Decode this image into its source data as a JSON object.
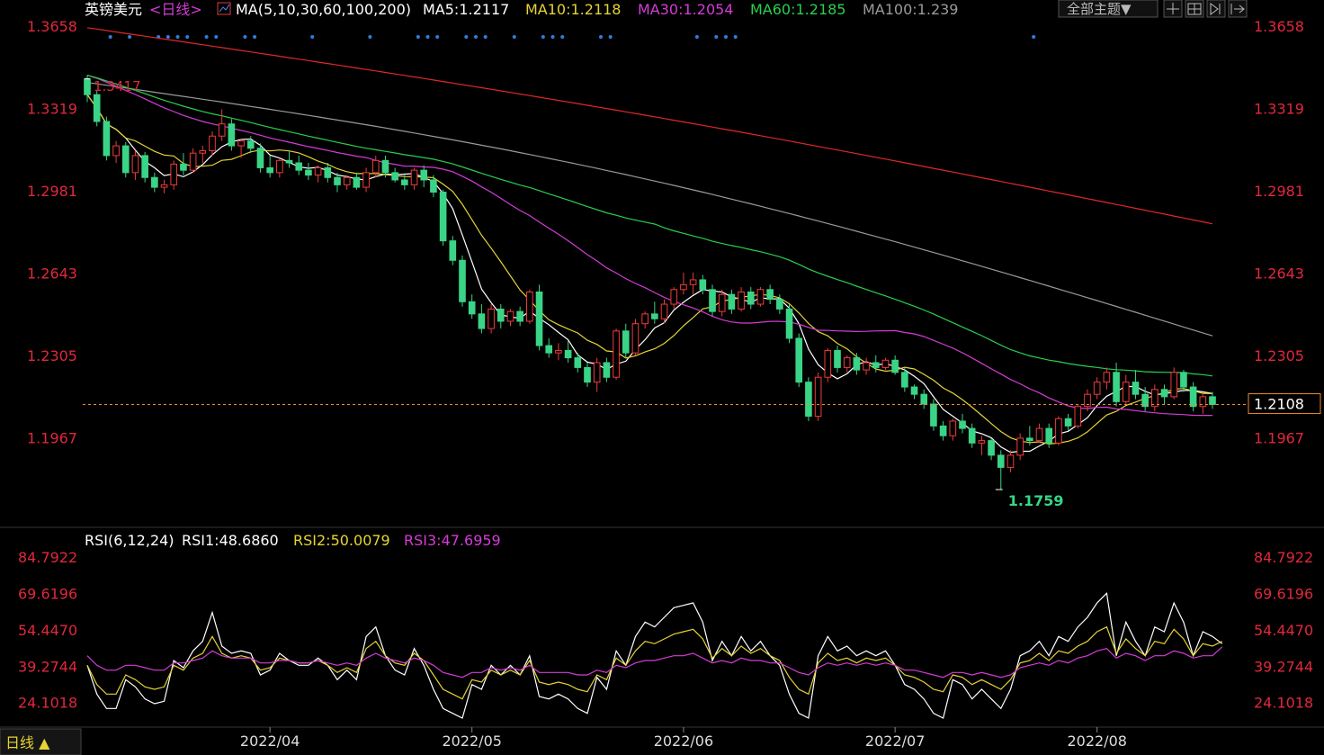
{
  "header": {
    "instrument": "英镑美元",
    "period_tag": "<日线>",
    "ma_def": "MA(5,10,30,60,100,200)",
    "ma5": "MA5:1.2117",
    "ma10": "MA10:1.2118",
    "ma30": "MA30:1.2054",
    "ma60": "MA60:1.2185",
    "ma100": "MA100:1.239",
    "theme_button": "全部主题▼"
  },
  "rsi_header": {
    "def": "RSI(6,12,24)",
    "rsi1": "RSI1:48.6860",
    "rsi2": "RSI2:50.0079",
    "rsi3": "RSI3:47.6959"
  },
  "bottom": {
    "period_button": "日线 ▲"
  },
  "colors": {
    "up": "#ef3b3b",
    "down": "#3ad486",
    "ma5": "#ffffff",
    "ma10": "#e6d335",
    "ma30": "#d43cd6",
    "ma60": "#29d04c",
    "ma100": "#9a9a9a",
    "ma200": "#e0282a",
    "axis_label": "#e0283c",
    "current_price_line": "#f08a2a",
    "dots": "#2f7de0"
  },
  "chart_data": [
    {
      "type": "candlestick",
      "title": "英镑美元<日线>",
      "y_ticks": [
        "1.3658",
        "1.3319",
        "1.2981",
        "1.2643",
        "1.2305",
        "1.1967"
      ],
      "ylim": [
        1.17,
        1.368
      ],
      "x_ticks": [
        "2022/04",
        "2022/05",
        "2022/06",
        "2022/07",
        "2022/08"
      ],
      "x_tick_index": [
        19,
        40,
        62,
        84,
        105
      ],
      "current_price": "1.2108",
      "high_label": "1.3417",
      "low_label": "1.1759",
      "ohlc": [
        [
          1.3445,
          1.346,
          1.335,
          1.338
        ],
        [
          1.338,
          1.3395,
          1.325,
          1.327
        ],
        [
          1.327,
          1.329,
          1.311,
          1.313
        ],
        [
          1.313,
          1.319,
          1.31,
          1.317
        ],
        [
          1.317,
          1.3185,
          1.304,
          1.306
        ],
        [
          1.306,
          1.315,
          1.303,
          1.313
        ],
        [
          1.313,
          1.3145,
          1.302,
          1.304
        ],
        [
          1.304,
          1.306,
          1.298,
          1.3
        ],
        [
          1.3,
          1.303,
          1.2975,
          1.301
        ],
        [
          1.301,
          1.311,
          1.299,
          1.3095
        ],
        [
          1.3095,
          1.314,
          1.305,
          1.307
        ],
        [
          1.307,
          1.316,
          1.306,
          1.314
        ],
        [
          1.314,
          1.317,
          1.31,
          1.315
        ],
        [
          1.315,
          1.323,
          1.313,
          1.321
        ],
        [
          1.321,
          1.332,
          1.319,
          1.326
        ],
        [
          1.326,
          1.328,
          1.315,
          1.317
        ],
        [
          1.317,
          1.32,
          1.312,
          1.319
        ],
        [
          1.319,
          1.321,
          1.314,
          1.316
        ],
        [
          1.316,
          1.318,
          1.306,
          1.308
        ],
        [
          1.308,
          1.313,
          1.304,
          1.306
        ],
        [
          1.306,
          1.312,
          1.304,
          1.311
        ],
        [
          1.311,
          1.315,
          1.308,
          1.31
        ],
        [
          1.31,
          1.313,
          1.305,
          1.307
        ],
        [
          1.307,
          1.31,
          1.303,
          1.305
        ],
        [
          1.305,
          1.309,
          1.302,
          1.308
        ],
        [
          1.308,
          1.31,
          1.302,
          1.304
        ],
        [
          1.304,
          1.306,
          1.298,
          1.301
        ],
        [
          1.301,
          1.305,
          1.299,
          1.304
        ],
        [
          1.304,
          1.306,
          1.299,
          1.3
        ],
        [
          1.3,
          1.308,
          1.298,
          1.306
        ],
        [
          1.306,
          1.313,
          1.304,
          1.311
        ],
        [
          1.311,
          1.313,
          1.304,
          1.306
        ],
        [
          1.306,
          1.308,
          1.302,
          1.303
        ],
        [
          1.303,
          1.305,
          1.299,
          1.301
        ],
        [
          1.301,
          1.308,
          1.299,
          1.307
        ],
        [
          1.307,
          1.309,
          1.3,
          1.303
        ],
        [
          1.303,
          1.305,
          1.296,
          1.298
        ],
        [
          1.298,
          1.299,
          1.276,
          1.278
        ],
        [
          1.278,
          1.28,
          1.268,
          1.27
        ],
        [
          1.27,
          1.272,
          1.251,
          1.253
        ],
        [
          1.253,
          1.256,
          1.246,
          1.248
        ],
        [
          1.248,
          1.252,
          1.24,
          1.242
        ],
        [
          1.242,
          1.252,
          1.24,
          1.25
        ],
        [
          1.25,
          1.252,
          1.242,
          1.245
        ],
        [
          1.245,
          1.25,
          1.243,
          1.249
        ],
        [
          1.249,
          1.251,
          1.243,
          1.245
        ],
        [
          1.245,
          1.258,
          1.244,
          1.257
        ],
        [
          1.257,
          1.26,
          1.233,
          1.235
        ],
        [
          1.235,
          1.238,
          1.23,
          1.232
        ],
        [
          1.232,
          1.236,
          1.229,
          1.233
        ],
        [
          1.233,
          1.237,
          1.228,
          1.23
        ],
        [
          1.23,
          1.232,
          1.224,
          1.226
        ],
        [
          1.226,
          1.228,
          1.218,
          1.22
        ],
        [
          1.22,
          1.23,
          1.216,
          1.228
        ],
        [
          1.228,
          1.23,
          1.22,
          1.222
        ],
        [
          1.222,
          1.242,
          1.221,
          1.241
        ],
        [
          1.241,
          1.244,
          1.23,
          1.232
        ],
        [
          1.232,
          1.246,
          1.231,
          1.244
        ],
        [
          1.244,
          1.249,
          1.242,
          1.248
        ],
        [
          1.248,
          1.253,
          1.244,
          1.246
        ],
        [
          1.246,
          1.254,
          1.244,
          1.252
        ],
        [
          1.252,
          1.259,
          1.25,
          1.258
        ],
        [
          1.258,
          1.265,
          1.256,
          1.26
        ],
        [
          1.26,
          1.265,
          1.256,
          1.262
        ],
        [
          1.262,
          1.264,
          1.256,
          1.258
        ],
        [
          1.258,
          1.26,
          1.247,
          1.249
        ],
        [
          1.249,
          1.258,
          1.247,
          1.256
        ],
        [
          1.256,
          1.258,
          1.248,
          1.25
        ],
        [
          1.25,
          1.259,
          1.249,
          1.257
        ],
        [
          1.257,
          1.259,
          1.25,
          1.252
        ],
        [
          1.252,
          1.259,
          1.251,
          1.258
        ],
        [
          1.258,
          1.26,
          1.252,
          1.254
        ],
        [
          1.254,
          1.256,
          1.248,
          1.25
        ],
        [
          1.25,
          1.252,
          1.236,
          1.238
        ],
        [
          1.238,
          1.24,
          1.218,
          1.22
        ],
        [
          1.22,
          1.222,
          1.204,
          1.206
        ],
        [
          1.206,
          1.224,
          1.204,
          1.222
        ],
        [
          1.222,
          1.234,
          1.22,
          1.233
        ],
        [
          1.233,
          1.235,
          1.224,
          1.226
        ],
        [
          1.226,
          1.231,
          1.224,
          1.23
        ],
        [
          1.23,
          1.232,
          1.223,
          1.225
        ],
        [
          1.225,
          1.23,
          1.223,
          1.228
        ],
        [
          1.228,
          1.231,
          1.224,
          1.226
        ],
        [
          1.226,
          1.23,
          1.225,
          1.229
        ],
        [
          1.229,
          1.231,
          1.223,
          1.224
        ],
        [
          1.224,
          1.226,
          1.216,
          1.218
        ],
        [
          1.218,
          1.219,
          1.213,
          1.215
        ],
        [
          1.215,
          1.217,
          1.209,
          1.211
        ],
        [
          1.211,
          1.213,
          1.2,
          1.202
        ],
        [
          1.202,
          1.204,
          1.196,
          1.198
        ],
        [
          1.198,
          1.205,
          1.196,
          1.204
        ],
        [
          1.204,
          1.207,
          1.199,
          1.201
        ],
        [
          1.201,
          1.203,
          1.193,
          1.195
        ],
        [
          1.195,
          1.198,
          1.19,
          1.196
        ],
        [
          1.196,
          1.197,
          1.188,
          1.19
        ],
        [
          1.19,
          1.192,
          1.1759,
          1.185
        ],
        [
          1.185,
          1.192,
          1.183,
          1.19
        ],
        [
          1.19,
          1.199,
          1.188,
          1.197
        ],
        [
          1.197,
          1.202,
          1.194,
          1.196
        ],
        [
          1.196,
          1.203,
          1.195,
          1.201
        ],
        [
          1.201,
          1.203,
          1.193,
          1.195
        ],
        [
          1.195,
          1.206,
          1.194,
          1.205
        ],
        [
          1.205,
          1.207,
          1.2,
          1.202
        ],
        [
          1.202,
          1.211,
          1.201,
          1.21
        ],
        [
          1.21,
          1.217,
          1.208,
          1.215
        ],
        [
          1.215,
          1.222,
          1.213,
          1.22
        ],
        [
          1.22,
          1.226,
          1.217,
          1.224
        ],
        [
          1.224,
          1.228,
          1.21,
          1.212
        ],
        [
          1.212,
          1.223,
          1.211,
          1.22
        ],
        [
          1.22,
          1.225,
          1.213,
          1.215
        ],
        [
          1.215,
          1.218,
          1.208,
          1.21
        ],
        [
          1.21,
          1.219,
          1.208,
          1.217
        ],
        [
          1.217,
          1.219,
          1.211,
          1.214
        ],
        [
          1.214,
          1.226,
          1.213,
          1.224
        ],
        [
          1.224,
          1.225,
          1.216,
          1.218
        ],
        [
          1.218,
          1.22,
          1.208,
          1.21
        ],
        [
          1.21,
          1.215,
          1.207,
          1.214
        ],
        [
          1.214,
          1.216,
          1.209,
          1.2108
        ]
      ],
      "ma": [
        {
          "name": "MA5",
          "start": 1.344,
          "end": 1.2117,
          "shape": "fast"
        },
        {
          "name": "MA10",
          "start": 1.343,
          "end": 1.2118,
          "shape": "medium"
        },
        {
          "name": "MA30",
          "start": 1.3435,
          "end": 1.2054,
          "shape": "slow"
        },
        {
          "name": "MA60",
          "start": 1.343,
          "end": 1.2185,
          "shape": "slower"
        },
        {
          "name": "MA100",
          "start": 1.342,
          "end": 1.239,
          "shape": "slowest"
        },
        {
          "name": "MA200",
          "start": 1.3655,
          "end": 1.285,
          "shape": "linear"
        }
      ]
    },
    {
      "type": "line",
      "title": "RSI(6,12,24)",
      "y_ticks": [
        "84.7922",
        "69.6196",
        "54.4470",
        "39.2744",
        "24.1018"
      ],
      "ylim": [
        15,
        90
      ],
      "series": [
        {
          "name": "RSI1",
          "values": [
            40,
            28,
            22,
            22,
            34,
            31,
            26,
            24,
            25,
            42,
            39,
            46,
            50,
            62,
            48,
            45,
            46,
            45,
            36,
            38,
            45,
            42,
            40,
            40,
            43,
            40,
            34,
            38,
            34,
            52,
            56,
            44,
            38,
            36,
            47,
            40,
            30,
            22,
            20,
            18,
            32,
            30,
            40,
            36,
            40,
            36,
            44,
            27,
            26,
            28,
            26,
            22,
            20,
            35,
            30,
            46,
            40,
            52,
            58,
            56,
            60,
            64,
            65,
            66,
            58,
            42,
            50,
            44,
            52,
            46,
            50,
            44,
            40,
            28,
            20,
            18,
            44,
            52,
            46,
            48,
            44,
            46,
            44,
            46,
            40,
            32,
            30,
            26,
            20,
            18,
            34,
            32,
            26,
            30,
            26,
            22,
            30,
            44,
            46,
            50,
            44,
            52,
            50,
            56,
            60,
            66,
            70,
            44,
            58,
            50,
            44,
            56,
            54,
            66,
            58,
            44,
            54,
            52,
            49
          ]
        },
        {
          "name": "RSI2",
          "values": [
            40,
            32,
            28,
            28,
            36,
            34,
            31,
            30,
            31,
            40,
            38,
            43,
            45,
            52,
            45,
            43,
            44,
            43,
            38,
            39,
            43,
            42,
            41,
            41,
            42,
            40,
            37,
            39,
            37,
            47,
            50,
            44,
            41,
            40,
            45,
            42,
            36,
            30,
            28,
            26,
            34,
            33,
            38,
            36,
            38,
            36,
            42,
            33,
            32,
            33,
            32,
            30,
            29,
            36,
            34,
            43,
            40,
            46,
            50,
            49,
            51,
            53,
            54,
            55,
            51,
            43,
            47,
            44,
            48,
            45,
            47,
            44,
            42,
            35,
            30,
            28,
            41,
            45,
            42,
            43,
            41,
            43,
            42,
            43,
            40,
            36,
            35,
            33,
            30,
            29,
            36,
            35,
            32,
            34,
            32,
            30,
            34,
            41,
            42,
            45,
            42,
            46,
            45,
            48,
            50,
            54,
            56,
            45,
            51,
            47,
            44,
            50,
            49,
            55,
            51,
            44,
            49,
            48,
            50
          ]
        },
        {
          "name": "RSI3",
          "values": [
            44,
            40,
            38,
            38,
            40,
            40,
            39,
            38,
            38,
            41,
            41,
            42,
            43,
            46,
            44,
            43,
            43,
            43,
            41,
            41,
            42,
            42,
            41,
            41,
            42,
            41,
            40,
            41,
            40,
            43,
            45,
            43,
            42,
            41,
            43,
            42,
            40,
            37,
            36,
            35,
            37,
            37,
            39,
            38,
            39,
            38,
            40,
            37,
            37,
            37,
            37,
            36,
            36,
            38,
            37,
            40,
            39,
            41,
            42,
            42,
            43,
            44,
            44,
            45,
            43,
            41,
            42,
            41,
            43,
            42,
            42,
            41,
            41,
            39,
            37,
            36,
            39,
            41,
            40,
            41,
            40,
            41,
            40,
            41,
            40,
            38,
            38,
            37,
            36,
            35,
            37,
            37,
            36,
            37,
            36,
            35,
            36,
            39,
            40,
            41,
            40,
            42,
            41,
            43,
            44,
            46,
            47,
            43,
            45,
            44,
            42,
            44,
            44,
            46,
            45,
            43,
            44,
            44,
            47.7
          ]
        }
      ]
    }
  ]
}
